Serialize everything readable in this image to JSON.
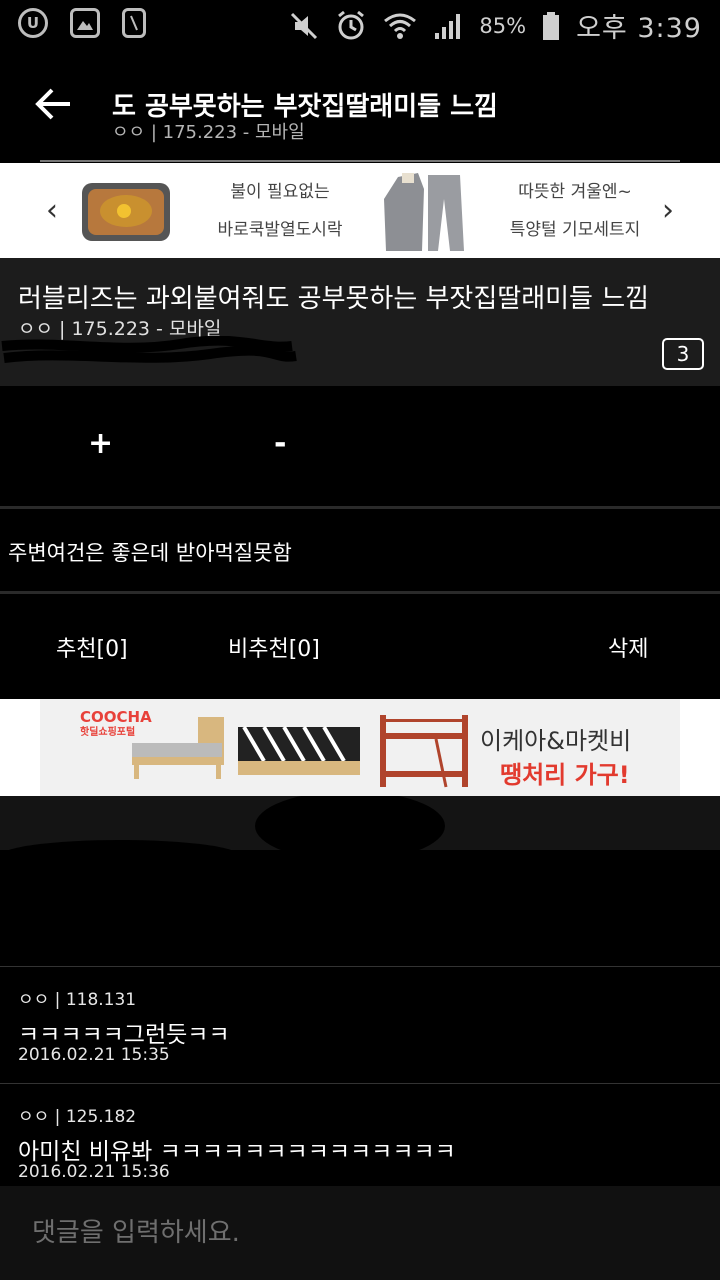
{
  "status_bar": {
    "battery": "85%",
    "time": "오후 3:39",
    "icons": [
      "u-plus-icon",
      "image-icon",
      "phone-notification-icon",
      "mute-icon",
      "alarm-icon",
      "wifi-icon",
      "signal-icon",
      "battery-icon"
    ]
  },
  "header": {
    "title": "도 공부못하는 부잣집딸래미들 느낌",
    "subtitle": "ㅇㅇ | 175.223 - 모바일"
  },
  "ad_banner_top": {
    "item1_line1": "불이 필요없는",
    "item1_line2": "바로쿡발열도시락",
    "item2_line1": "따뜻한 겨울엔~",
    "item2_line2": "특양털 기모세트지"
  },
  "post": {
    "title": "러블리즈는 과외붙여줘도 공부못하는 부잣집딸래미들 느낌",
    "meta": "ㅇㅇ | 175.223 - 모바일",
    "comment_count": "3",
    "vote_plus": "+",
    "vote_minus": "-",
    "body": "주변여건은 좋은데 받아먹질못함"
  },
  "actions": {
    "recommend": "추천[0]",
    "not_recommend": "비추천[0]",
    "delete": "삭제"
  },
  "ad_banner_bottom": {
    "logo": "COOCHA",
    "logo_sub": "핫딜쇼핑포털",
    "line1": "이케아&마켓비",
    "line2": "땡처리 가구!"
  },
  "comments": [
    {
      "author": "ㅇㅇ | 118.131",
      "text": "ㅋㅋㅋㅋㅋ그런듯ㅋㅋ",
      "date": "2016.02.21 15:35"
    },
    {
      "author": "ㅇㅇ | 125.182",
      "text": "아미친 비유봐 ㅋㅋㅋㅋㅋㅋㅋㅋㅋㅋㅋㅋㅋㅋ",
      "date": "2016.02.21 15:36"
    }
  ],
  "comment_input": {
    "placeholder": "댓글을 입력하세요."
  },
  "colors": {
    "background": "#000000",
    "post_head_bg": "#1c1c1c",
    "ad_accent": "#e23a2e"
  }
}
